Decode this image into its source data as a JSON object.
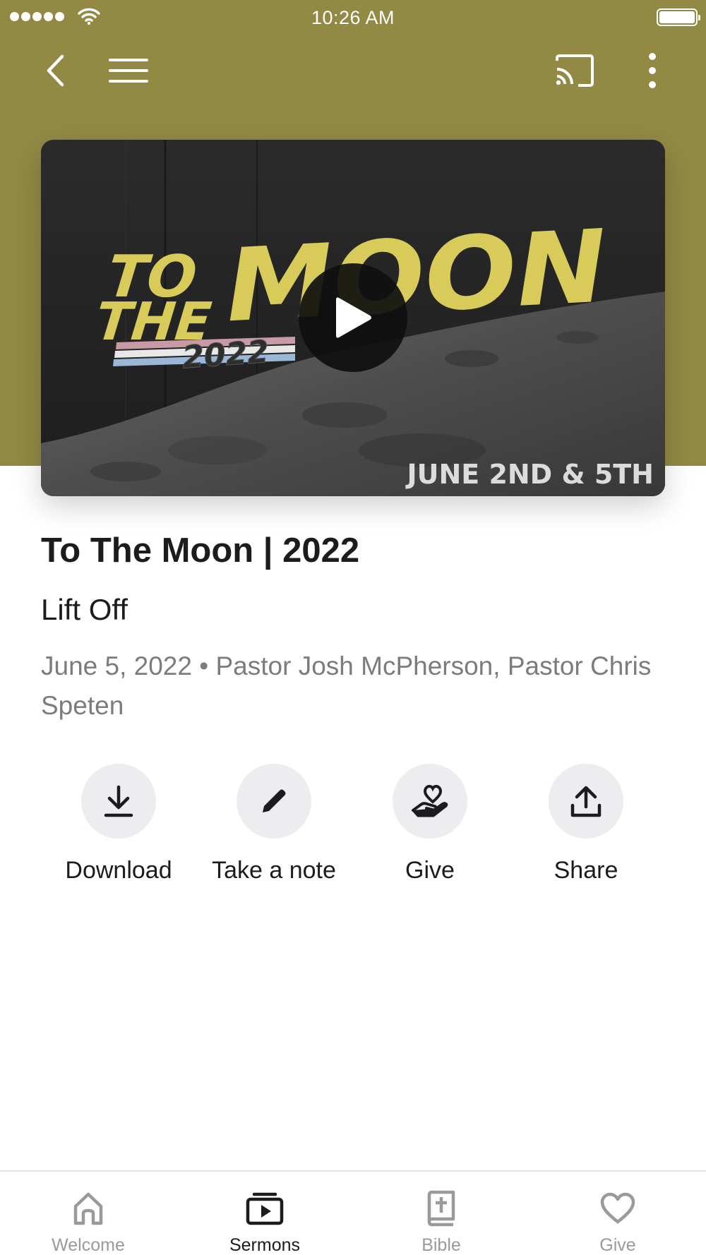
{
  "status_bar": {
    "time": "10:26 AM",
    "signal_icon": "signal-dots-icon",
    "wifi_icon": "wifi-icon",
    "battery_icon": "battery-icon"
  },
  "nav": {
    "back_icon": "chevron-left-icon",
    "menu_icon": "hamburger-menu-icon",
    "cast_icon": "cast-icon",
    "more_icon": "more-vertical-icon"
  },
  "colors": {
    "header": "#918944",
    "accent_yellow": "#d8cb5a",
    "tab_active": "#1c1c1e",
    "tab_inactive": "#9a9a9e"
  },
  "video": {
    "art_line1": "TO",
    "art_line2": "THE",
    "art_big": "MOON",
    "art_year": "2022",
    "art_dates": "JUNE 2ND & 5TH",
    "play_icon": "play-icon"
  },
  "sermon": {
    "title": "To The Moon | 2022",
    "subtitle": "Lift Off",
    "meta": "June 5, 2022 • Pastor Josh McPherson, Pastor Chris Speten"
  },
  "actions": [
    {
      "label": "Download",
      "icon": "download-icon"
    },
    {
      "label": "Take a note",
      "icon": "pencil-icon"
    },
    {
      "label": "Give",
      "icon": "hand-heart-icon"
    },
    {
      "label": "Share",
      "icon": "share-icon"
    }
  ],
  "tabs": [
    {
      "label": "Welcome",
      "icon": "home-icon",
      "active": false
    },
    {
      "label": "Sermons",
      "icon": "video-library-icon",
      "active": true
    },
    {
      "label": "Bible",
      "icon": "bible-icon",
      "active": false
    },
    {
      "label": "Give",
      "icon": "heart-icon",
      "active": false
    }
  ]
}
